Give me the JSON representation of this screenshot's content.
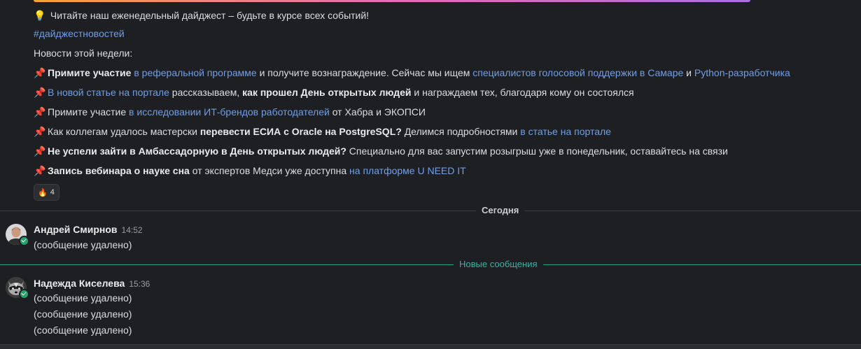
{
  "digest": {
    "intro_emoji": "💡",
    "intro": "Читайте наш еженедельный дайджест – будьте в курсе всех событий!",
    "hashtag": "#дайджестновостей",
    "week_title": "Новости этой недели:",
    "pin_emoji": "📌",
    "items": [
      {
        "p1_bold": "Примите участие",
        "p2_link": " в реферальной программе",
        "p3": " и получите вознаграждение. Сейчас мы ищем ",
        "p4_link": "специалистов голосовой поддержки в Самаре",
        "p5": " и ",
        "p6_link": "Python-разработчика"
      },
      {
        "p1_link": "В новой статье на портале",
        "p2": " рассказываем, ",
        "p3_bold": "как прошел День открытых людей",
        "p4": " и награждаем тех, благодаря кому он состоялся"
      },
      {
        "p1": "Примите участие ",
        "p2_link": "в исследовании ИТ-брендов работодателей",
        "p3": " от Хабра и ЭКОПСИ"
      },
      {
        "p1": "Как коллегам удалось мастерски ",
        "p2_bold": "перевести ЕСИА с Oracle на PostgreSQL?",
        "p3": " Делимся подробностями ",
        "p4_link": "в статье на портале"
      },
      {
        "p1_bold": "Не успели зайти в Амбассадорную в День открытых людей?",
        "p2": " Специально для вас запустим розыгрыш уже в понедельник, оставайтесь на связи"
      },
      {
        "p1_bold": "Запись вебинара о науке сна",
        "p2": " от экспертов Медси уже доступна ",
        "p3_link": "на платформе U NEED IT"
      }
    ],
    "reaction": {
      "emoji": "🔥",
      "count": "4"
    }
  },
  "dividers": {
    "today": "Сегодня",
    "new_messages": "Новые сообщения"
  },
  "messages": [
    {
      "author": "Андрей Смирнов",
      "time": "14:52",
      "lines": [
        "(сообщение удалено)"
      ]
    },
    {
      "author": "Надежда Киселева",
      "time": "15:36",
      "lines": [
        "(сообщение удалено)",
        "(сообщение удалено)",
        "(сообщение удалено)"
      ]
    }
  ],
  "colors": {
    "background": "#1e1f22",
    "link": "#6f9fe8",
    "new_divider": "#2e9c8f",
    "online": "#24a36b"
  }
}
